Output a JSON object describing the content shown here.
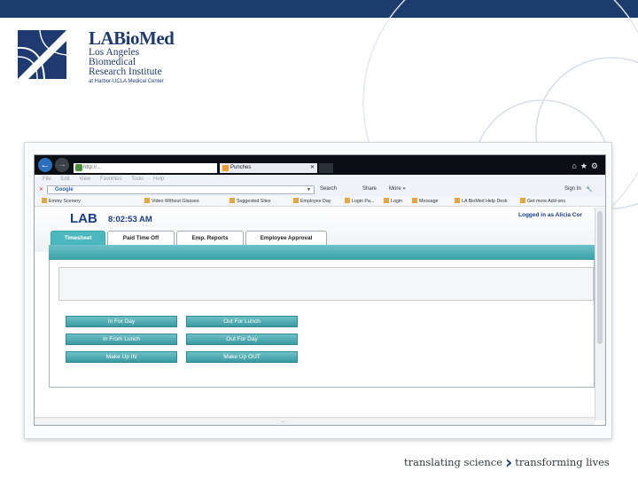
{
  "brand": {
    "name": "LABioMed",
    "line1": "Los Angeles",
    "line2": "Biomedical",
    "line3": "Research Institute",
    "sub": "at Harbor-UCLA Medical Center"
  },
  "browser": {
    "address": "http://...",
    "tab_title": "Punches",
    "menu": [
      "File",
      "Edit",
      "View",
      "Favorites",
      "Tools",
      "Help"
    ],
    "toolbar": {
      "search_provider": "Google",
      "search_label": "Search",
      "share_label": "Share",
      "more_label": "More »",
      "signin_label": "Sign In"
    },
    "favorites": [
      "Emmy Scenery",
      "Video Without Glasses",
      "Suggested Sites",
      "Employee Day",
      "Login Pa...",
      "Login",
      "Message",
      "LA BioMed Help Desk",
      "Get more Add-ons"
    ]
  },
  "app": {
    "brand": "LAB",
    "clock": "8:02:53 AM",
    "user": "Logged in as Alicia Cor",
    "tabs": [
      "Timesheet",
      "Paid Time Off",
      "Emp. Reports",
      "Employee Approval"
    ],
    "active_tab": "Timesheet",
    "actions": [
      "In For Day",
      "Out For Lunch",
      "In From Lunch",
      "Out For Day",
      "Make Up IN",
      "Make Up OUT"
    ]
  },
  "tagline": {
    "left": "translating science",
    "right": "transforming lives"
  },
  "colors": {
    "navy": "#1c3d6b",
    "teal": "#4db7bf",
    "app_blue": "#1b3e86"
  }
}
